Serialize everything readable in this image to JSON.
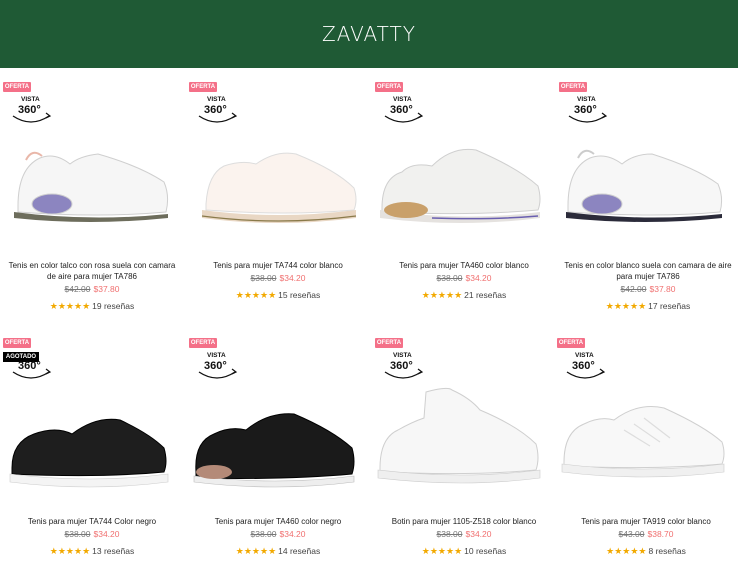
{
  "header": {
    "logo": "ZAVATTY",
    "bg_color": "#1f5a35"
  },
  "badges": {
    "oferta": "OFERTA",
    "agotado": "AGOTADO",
    "vista": "VISTA",
    "deg": "360°"
  },
  "colors": {
    "accent_price": "#f07070",
    "star": "#f2a900",
    "badge": "#f47088"
  },
  "products": [
    {
      "title": "Tenis en color talco con rosa suela con camara de aire para mujer TA786",
      "price_old": "$42.00",
      "price_new": "$37.80",
      "stars": "★★★★★",
      "reviews": "19 reseñas",
      "sold_out": false
    },
    {
      "title": "Tenis para mujer TA744 color blanco",
      "price_old": "$38.00",
      "price_new": "$34.20",
      "stars": "★★★★★",
      "reviews": "15 reseñas",
      "sold_out": false
    },
    {
      "title": "Tenis para mujer TA460 color blanco",
      "price_old": "$38.00",
      "price_new": "$34.20",
      "stars": "★★★★★",
      "reviews": "21 reseñas",
      "sold_out": false
    },
    {
      "title": "Tenis en color blanco suela con camara de aire para mujer TA786",
      "price_old": "$42.00",
      "price_new": "$37.80",
      "stars": "★★★★★",
      "reviews": "17 reseñas",
      "sold_out": false
    },
    {
      "title": "Tenis para mujer TA744 Color negro",
      "price_old": "$38.00",
      "price_new": "$34.20",
      "stars": "★★★★★",
      "reviews": "13 reseñas",
      "sold_out": true
    },
    {
      "title": "Tenis para mujer TA460 color negro",
      "price_old": "$38.00",
      "price_new": "$34.20",
      "stars": "★★★★★",
      "reviews": "14 reseñas",
      "sold_out": false
    },
    {
      "title": "Botin para mujer 1105-Z518 color blanco",
      "price_old": "$38.00",
      "price_new": "$34.20",
      "stars": "★★★★★",
      "reviews": "10 reseñas",
      "sold_out": false
    },
    {
      "title": "Tenis para mujer TA919 color blanco",
      "price_old": "$43.00",
      "price_new": "$38.70",
      "stars": "★★★★★",
      "reviews": "8 reseñas",
      "sold_out": false
    }
  ]
}
